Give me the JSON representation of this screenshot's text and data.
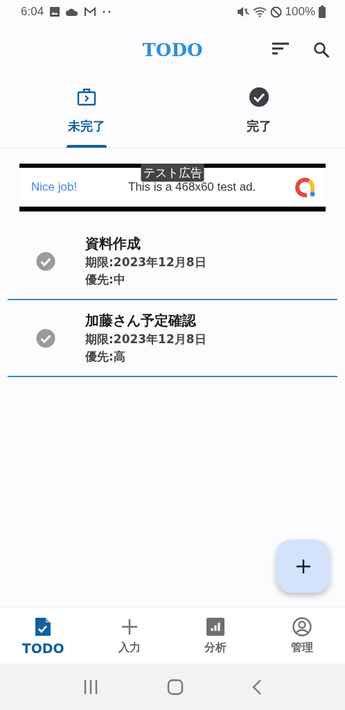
{
  "status_bar": {
    "time": "6:04",
    "battery": "100%"
  },
  "app_bar": {
    "title": "TODO"
  },
  "tabs": [
    {
      "label": "未完了",
      "selected": true
    },
    {
      "label": "完了",
      "selected": false
    }
  ],
  "ad": {
    "label": "テスト広告",
    "headline": "Nice job!",
    "text": "This is a 468x60 test ad."
  },
  "todos": [
    {
      "title": "資料作成",
      "due": "期限:2023年12月8日",
      "priority": "優先:中"
    },
    {
      "title": "加藤さん予定確認",
      "due": "期限:2023年12月8日",
      "priority": "優先:高"
    }
  ],
  "bottom_nav": [
    {
      "label": "TODO",
      "selected": true
    },
    {
      "label": "入力",
      "selected": false
    },
    {
      "label": "分析",
      "selected": false
    },
    {
      "label": "管理",
      "selected": false
    }
  ]
}
